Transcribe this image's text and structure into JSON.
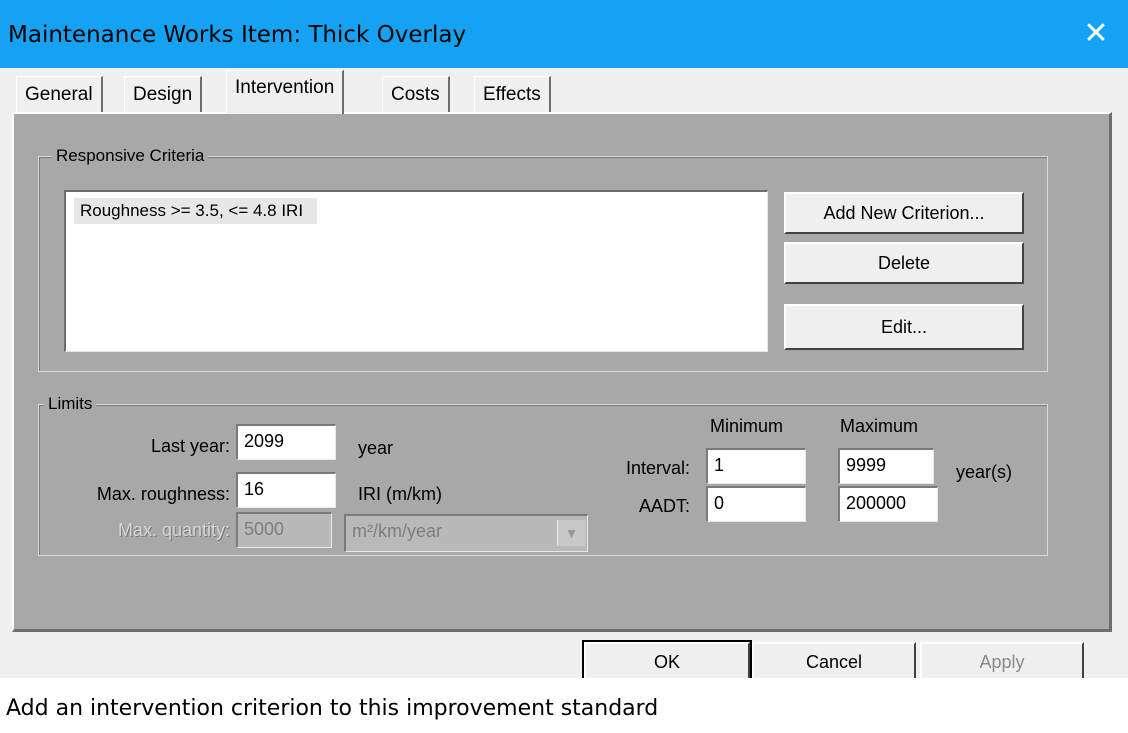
{
  "window": {
    "title": "Maintenance Works Item: Thick Overlay",
    "close_glyph": "✕"
  },
  "tabs": [
    {
      "label": "General",
      "active": false
    },
    {
      "label": "Design",
      "active": false
    },
    {
      "label": "Intervention",
      "active": true
    },
    {
      "label": "Costs",
      "active": false
    },
    {
      "label": "Effects",
      "active": false
    }
  ],
  "responsive_criteria": {
    "group_label": "Responsive Criteria",
    "items": [
      "Roughness >= 3.5, <= 4.8 IRI"
    ],
    "add_button": "Add New Criterion...",
    "delete_button": "Delete",
    "edit_button": "Edit..."
  },
  "limits": {
    "group_label": "Limits",
    "last_year": {
      "label": "Last year:",
      "value": "2099",
      "unit": "year"
    },
    "max_roughness": {
      "label": "Max. roughness:",
      "value": "16",
      "unit": "IRI (m/km)"
    },
    "max_quantity": {
      "label": "Max. quantity:",
      "value": "5000",
      "unit": "m²/km/year",
      "disabled": true
    },
    "minimum_header": "Minimum",
    "maximum_header": "Maximum",
    "interval": {
      "label": "Interval:",
      "min": "1",
      "max": "9999",
      "unit": "year(s)"
    },
    "aadt": {
      "label": "AADT:",
      "min": "0",
      "max": "200000"
    }
  },
  "footer": {
    "ok": "OK",
    "cancel": "Cancel",
    "apply": "Apply"
  },
  "status_bar": "Add an intervention criterion to this improvement standard"
}
